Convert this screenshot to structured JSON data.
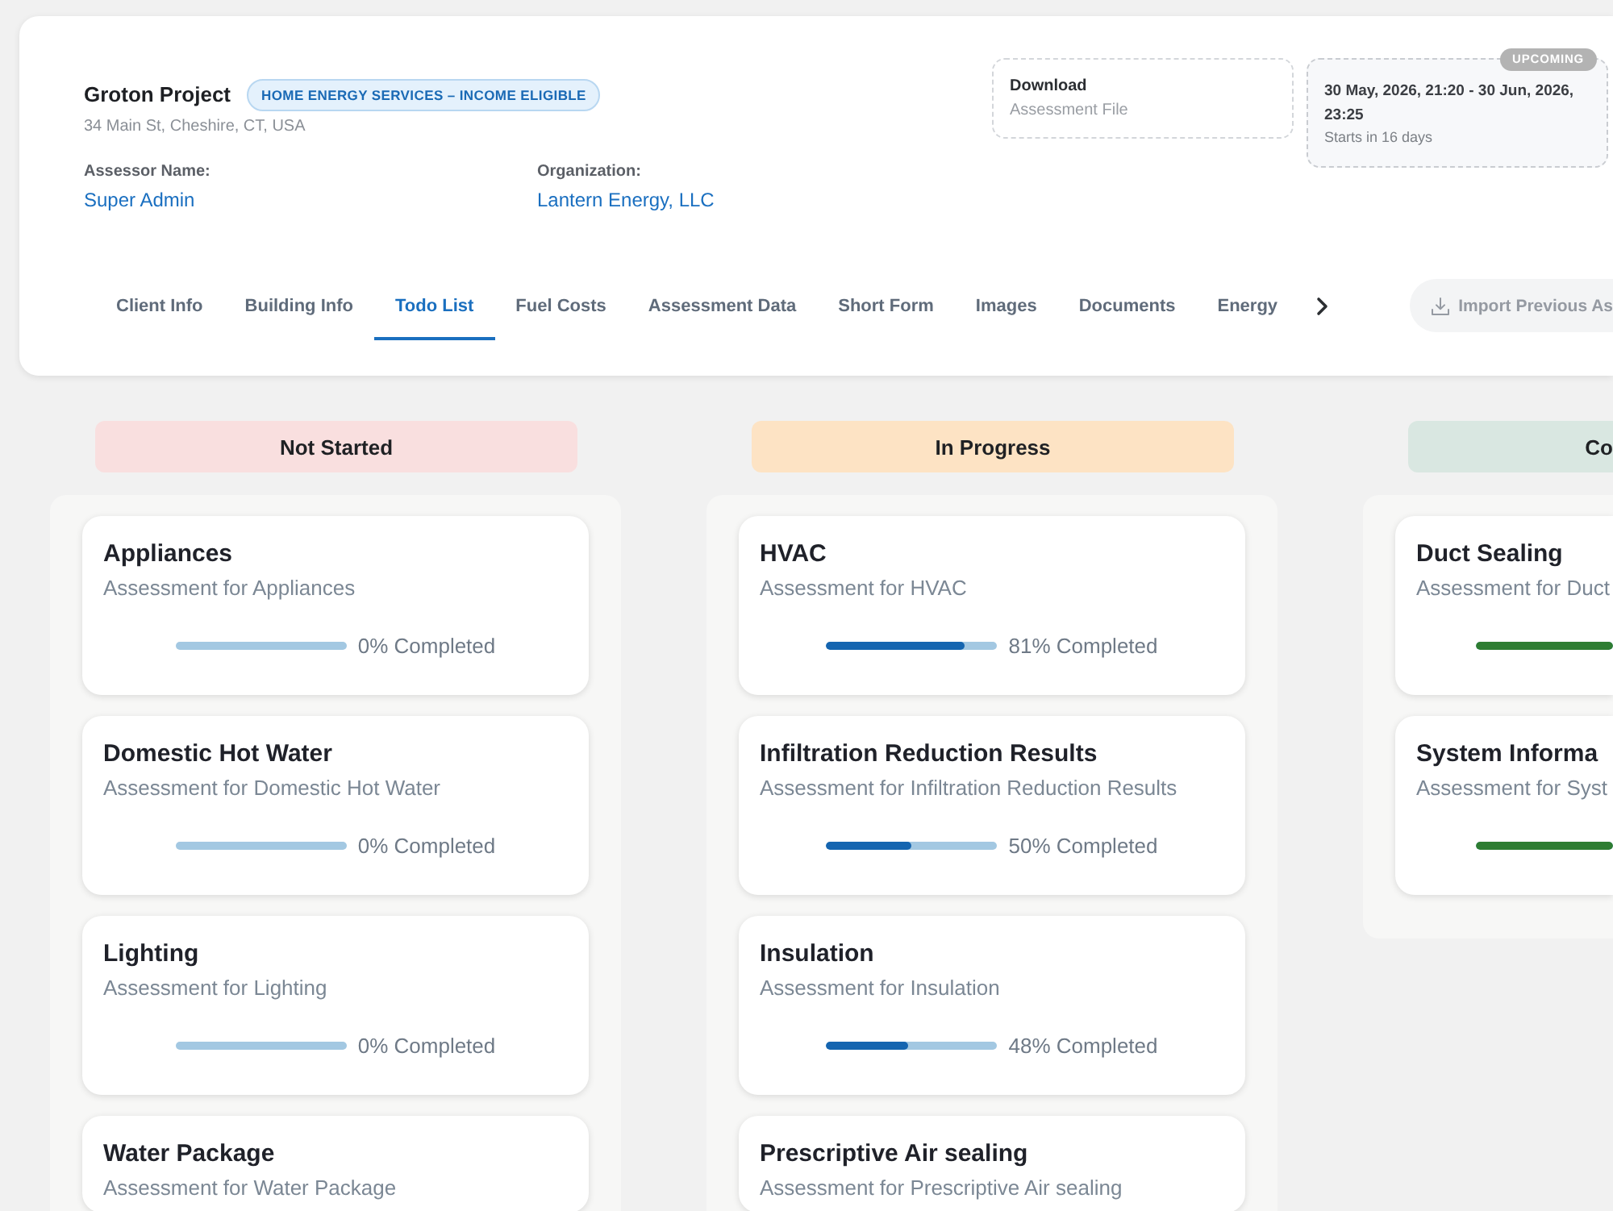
{
  "project": {
    "name": "Groton Project",
    "program_badge": "HOME ENERGY SERVICES – INCOME ELIGIBLE",
    "address": "34 Main St, Cheshire, CT, USA"
  },
  "details": [
    {
      "label": "Assessor Name:",
      "value": "Super Admin"
    },
    {
      "label": "Organization:",
      "value": "Lantern Energy, LLC"
    }
  ],
  "download": {
    "title": "Download",
    "subtitle": "Assessment File"
  },
  "schedule": {
    "status": "UPCOMING",
    "range": "30 May, 2026, 21:20 - 30 Jun, 2026, 23:25",
    "note": "Starts in 16 days"
  },
  "tabs": [
    {
      "label": "Client Info",
      "selected": false
    },
    {
      "label": "Building Info",
      "selected": false
    },
    {
      "label": "Todo List",
      "selected": true
    },
    {
      "label": "Fuel Costs",
      "selected": false
    },
    {
      "label": "Assessment Data",
      "selected": false
    },
    {
      "label": "Short Form",
      "selected": false
    },
    {
      "label": "Images",
      "selected": false
    },
    {
      "label": "Documents",
      "selected": false
    },
    {
      "label": "Energy",
      "selected": false
    }
  ],
  "import_button": {
    "label": "Import Previous As",
    "disabled": true
  },
  "board": {
    "columns": [
      {
        "title": "Not Started",
        "color": "#f9dfdf",
        "cards": [
          {
            "title": "Appliances",
            "description": "Assessment for Appliances",
            "level": 0,
            "progress_label": "0% Completed"
          },
          {
            "title": "Domestic Hot Water",
            "description": "Assessment for Domestic Hot Water",
            "level": 0,
            "progress_label": "0% Completed"
          },
          {
            "title": "Lighting",
            "description": "Assessment for Lighting",
            "level": 0,
            "progress_label": "0% Completed"
          },
          {
            "title": "Water Package",
            "description": "Assessment for Water Package"
          }
        ]
      },
      {
        "title": "In Progress",
        "color": "#fde3c4",
        "cards": [
          {
            "title": "HVAC",
            "description": "Assessment for HVAC",
            "level": 0.81,
            "progress_label": "81% Completed"
          },
          {
            "title": "Infiltration Reduction Results",
            "description": "Assessment for Infiltration Reduction Results",
            "level": 0.5,
            "progress_label": "50% Completed"
          },
          {
            "title": "Insulation",
            "description": "Assessment for Insulation",
            "level": 0.48,
            "progress_label": "48% Completed"
          },
          {
            "title": "Prescriptive Air sealing",
            "description": "Assessment for Prescriptive Air sealing"
          }
        ]
      },
      {
        "title": "Co",
        "color": "#d9e7e1",
        "cards": [
          {
            "title": "Duct Sealing",
            "description": "Assessment for Duct",
            "level": 1
          },
          {
            "title": "System Informa",
            "description": "Assessment for Syst",
            "level": 1
          }
        ]
      }
    ]
  }
}
